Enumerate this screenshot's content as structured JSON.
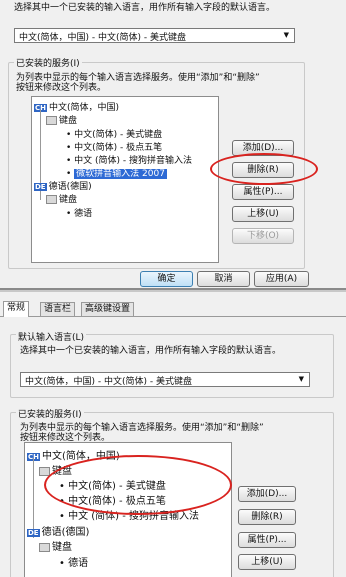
{
  "top": {
    "description": "选择其中一个已安装的输入语言，用作所有输入字段的默认语言。",
    "combo_value": "中文(简体，中国) - 中文(简体) - 美式键盘",
    "group_title": "已安装的服务(I)",
    "group_desc_1": "为列表中显示的每个输入语言选择服务。使用“添加”和“删除”",
    "group_desc_2": "按钮来修改这个列表。",
    "tree": {
      "lang1": "中文(简体，中国)",
      "lang1_badge": "CH",
      "keyboard": "键盘",
      "item1": "中文(简体) - 美式键盘",
      "item2": "中文(简体) - 极点五笔",
      "item3": "中文 (简体) - 搜狗拼音输入法",
      "item4": "微软拼音输入法 2007",
      "lang2": "德语(德国)",
      "lang2_badge": "DE",
      "keyboard2": "键盘",
      "item5": "德语"
    },
    "buttons": {
      "add": "添加(D)...",
      "remove": "删除(R)",
      "properties": "属性(P)...",
      "up": "上移(U)",
      "down": "下移(O)"
    },
    "footer": {
      "ok": "确定",
      "cancel": "取消",
      "apply": "应用(A)"
    }
  },
  "bottom": {
    "tabs": [
      "常规",
      "语言栏",
      "高级键设置"
    ],
    "group1_title": "默认输入语言(L)",
    "description": "选择其中一个已安装的输入语言，用作所有输入字段的默认语言。",
    "combo_value": "中文(简体，中国) - 中文(简体) - 美式键盘",
    "group_title": "已安装的服务(I)",
    "group_desc_1": "为列表中显示的每个输入语言选择服务。使用“添加”和“删除”",
    "group_desc_2": "按钮来修改这个列表。",
    "tree": {
      "lang1": "中文(简体，中国)",
      "lang1_badge": "CH",
      "keyboard": "键盘",
      "item1": "中文(简体) - 美式键盘",
      "item2": "中文(简体) - 极点五笔",
      "item3": "中文 (简体) - 搜狗拼音输入法",
      "lang2": "德语(德国)",
      "lang2_badge": "DE",
      "keyboard2": "键盘",
      "item5": "德语"
    },
    "buttons": {
      "add": "添加(D)...",
      "remove": "删除(R)",
      "properties": "属性(P)...",
      "up": "上移(U)"
    }
  },
  "colors": {
    "highlight": "#2d6ad5",
    "annotation": "#d9231f"
  }
}
